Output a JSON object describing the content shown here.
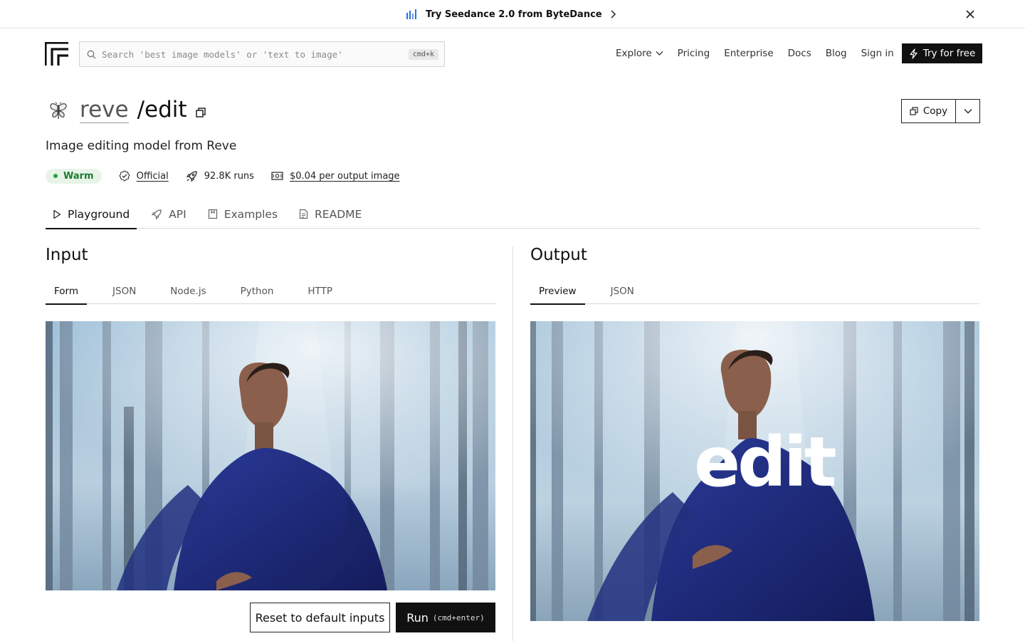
{
  "banner": {
    "text": "Try Seedance 2.0 from ByteDance"
  },
  "search": {
    "placeholder": "Search 'best image models' or 'text to image'",
    "shortcut": "cmd+k"
  },
  "nav": {
    "explore": "Explore",
    "pricing": "Pricing",
    "enterprise": "Enterprise",
    "docs": "Docs",
    "blog": "Blog",
    "signin": "Sign in",
    "try": "Try for free"
  },
  "model": {
    "owner": "reve",
    "slash": "/",
    "name": "edit",
    "description": "Image editing model from Reve",
    "copy_label": "Copy"
  },
  "meta": {
    "status": "Warm",
    "official": "Official",
    "runs": "92.8K runs",
    "price": "$0.04 per output image"
  },
  "tabs": [
    "Playground",
    "API",
    "Examples",
    "README"
  ],
  "input": {
    "title": "Input",
    "tabs": [
      "Form",
      "JSON",
      "Node.js",
      "Python",
      "HTTP"
    ]
  },
  "output": {
    "title": "Output",
    "tabs": [
      "Preview",
      "JSON"
    ],
    "overlay_text": "edit"
  },
  "buttons": {
    "reset": "Reset to default inputs",
    "run": "Run",
    "run_hint": "(cmd+enter)"
  },
  "colors": {
    "accent": "#111111",
    "warm_bg": "#e7f4e8",
    "warm_text": "#1f7a33",
    "dress": "#1e2a78",
    "fog": "#b9cfe0"
  }
}
